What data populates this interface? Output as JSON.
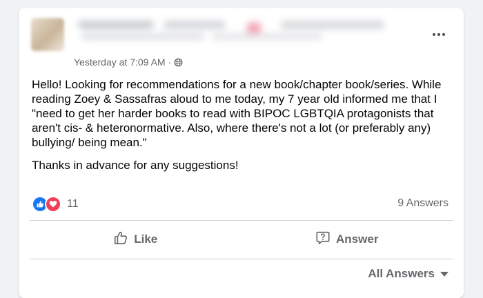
{
  "post": {
    "timestamp": "Yesterday at 7:09 AM",
    "separator": "·",
    "privacy_icon": "globe-icon",
    "paragraphs": [
      "Hello! Looking for recommendations for a new book/chapter book/series. While reading Zoey & Sassafras aloud to me today, my 7 year old informed me that I \"need to get her harder books to read with BIPOC LGBTQIA protagonists that aren't cis- & heteronormative. Also, where there's not a lot (or preferably any) bullying/ being mean.\"",
      "Thanks in advance for any suggestions!"
    ]
  },
  "engagement": {
    "reaction_icons": [
      "like-icon",
      "love-icon"
    ],
    "reaction_count": "11",
    "answers_count": "9 Answers"
  },
  "actions": {
    "like_label": "Like",
    "answer_label": "Answer"
  },
  "footer": {
    "all_answers_label": "All Answers"
  },
  "colors": {
    "background": "#f0f2f5",
    "card": "#ffffff",
    "secondary_text": "#65676b",
    "like_blue": "#1877f2",
    "love_red": "#f33e58"
  }
}
